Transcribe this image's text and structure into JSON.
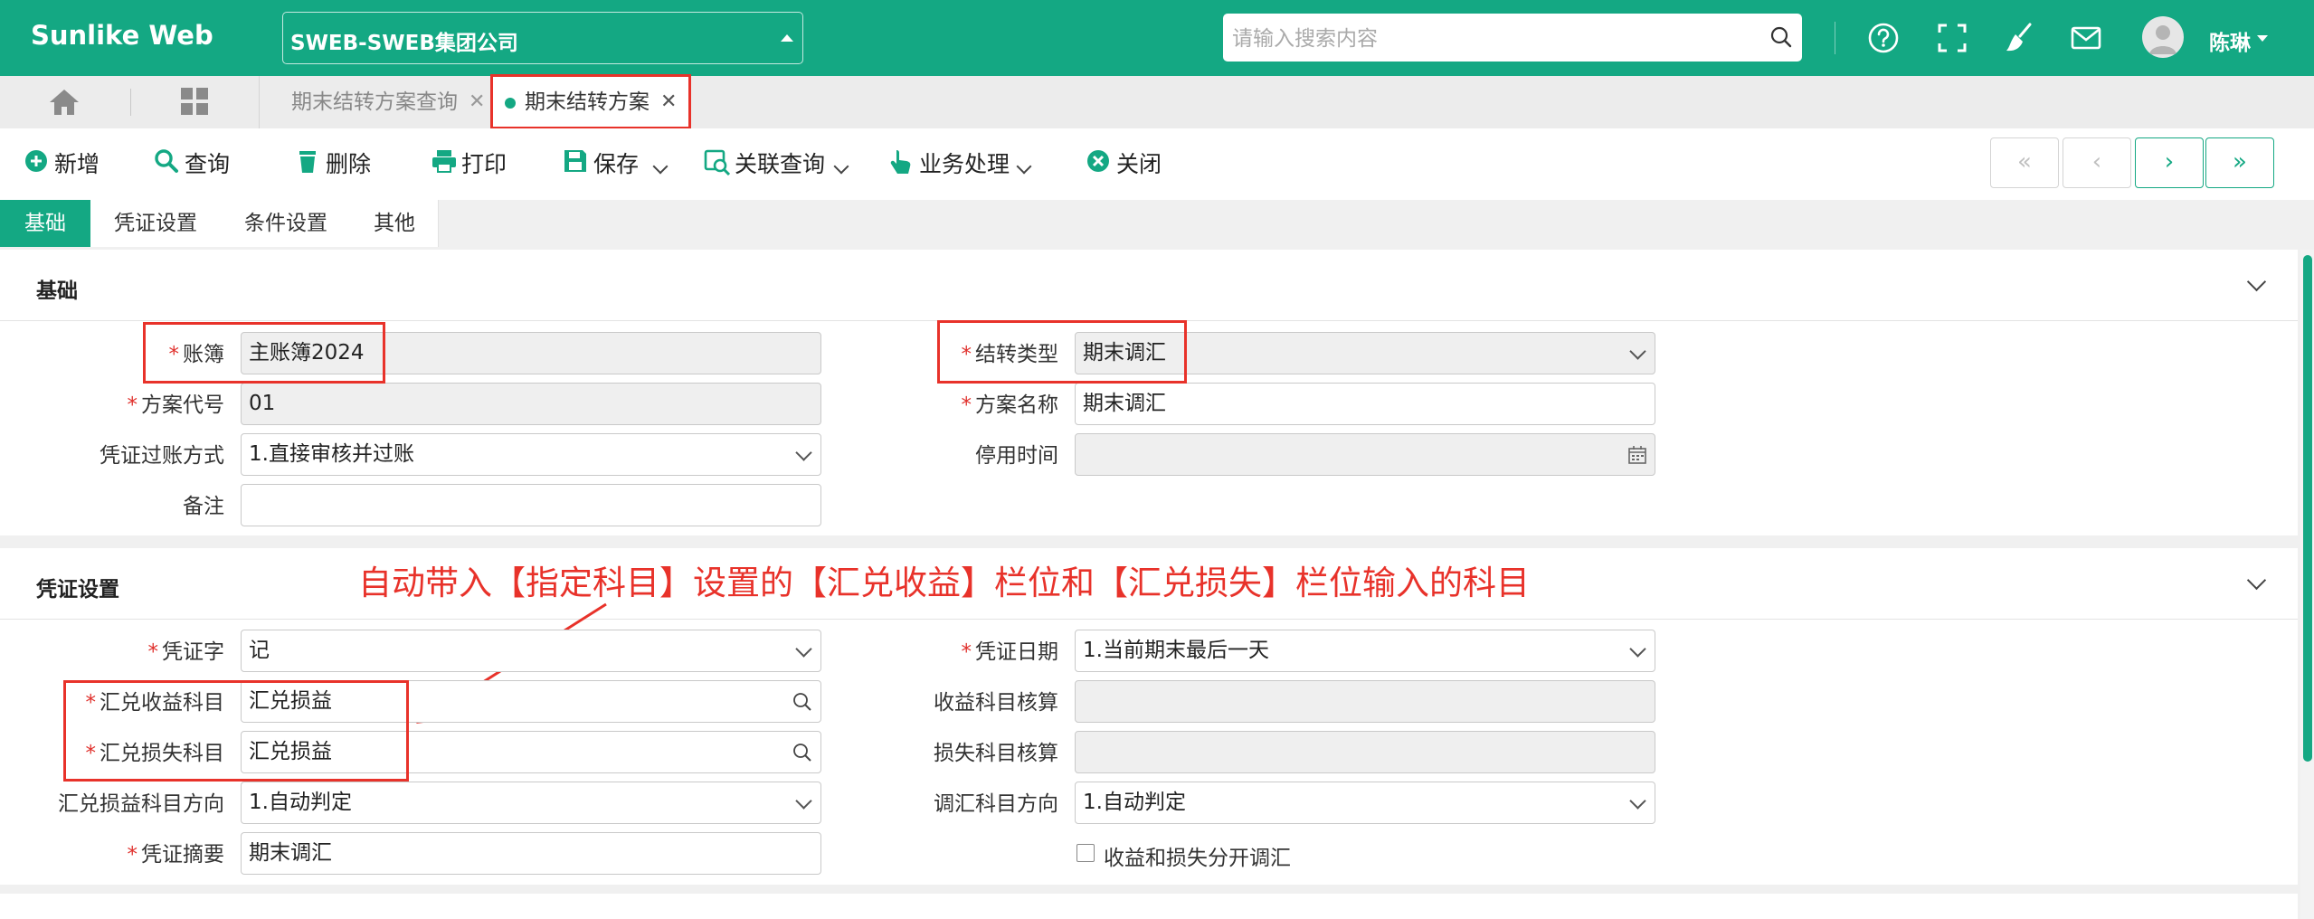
{
  "app": {
    "title": "Sunlike Web"
  },
  "header": {
    "company": "SWEB-SWEB集团公司",
    "search_placeholder": "请输入搜索内容",
    "username": "陈琳"
  },
  "tabs": {
    "items": [
      {
        "label": "期末结转方案查询",
        "active": false
      },
      {
        "label": "期末结转方案",
        "active": true
      }
    ]
  },
  "toolbar": {
    "add": "新增",
    "query": "查询",
    "delete": "删除",
    "print": "打印",
    "save": "保存",
    "related_query": "关联查询",
    "business": "业务处理",
    "close": "关闭",
    "nav": [
      "«",
      "‹",
      "›",
      "»"
    ]
  },
  "section_tabs": [
    "基础",
    "凭证设置",
    "条件设置",
    "其他"
  ],
  "basic": {
    "title": "基础",
    "fields": {
      "ledger": {
        "label": "账簿",
        "value": "主账簿2024",
        "required": true
      },
      "transfer_type": {
        "label": "结转类型",
        "value": "期末调汇",
        "required": true
      },
      "plan_code": {
        "label": "方案代号",
        "value": "01",
        "required": true
      },
      "plan_name": {
        "label": "方案名称",
        "value": "期末调汇",
        "required": true
      },
      "posting_method": {
        "label": "凭证过账方式",
        "value": "1.直接审核并过账"
      },
      "disable_time": {
        "label": "停用时间",
        "value": ""
      },
      "remark": {
        "label": "备注",
        "value": ""
      }
    }
  },
  "voucher": {
    "title": "凭证设置",
    "annotation": "自动带入【指定科目】设置的【汇兑收益】栏位和【汇兑损失】栏位输入的科目",
    "fields": {
      "voucher_word": {
        "label": "凭证字",
        "value": "记",
        "required": true
      },
      "voucher_date": {
        "label": "凭证日期",
        "value": "1.当前期末最后一天",
        "required": true
      },
      "gain_account": {
        "label": "汇兑收益科目",
        "value": "汇兑损益",
        "required": true
      },
      "gain_accounting": {
        "label": "收益科目核算",
        "value": ""
      },
      "loss_account": {
        "label": "汇兑损失科目",
        "value": "汇兑损益",
        "required": true
      },
      "loss_accounting": {
        "label": "损失科目核算",
        "value": ""
      },
      "pl_direction": {
        "label": "汇兑损益科目方向",
        "value": "1.自动判定"
      },
      "adj_direction": {
        "label": "调汇科目方向",
        "value": "1.自动判定"
      },
      "summary": {
        "label": "凭证摘要",
        "value": "期末调汇",
        "required": true
      },
      "separate_adjust": {
        "label": "收益和损失分开调汇",
        "checked": false
      }
    }
  },
  "colors": {
    "brand": "#14a883",
    "annotation": "#e8322a",
    "required": "#e0302c"
  }
}
